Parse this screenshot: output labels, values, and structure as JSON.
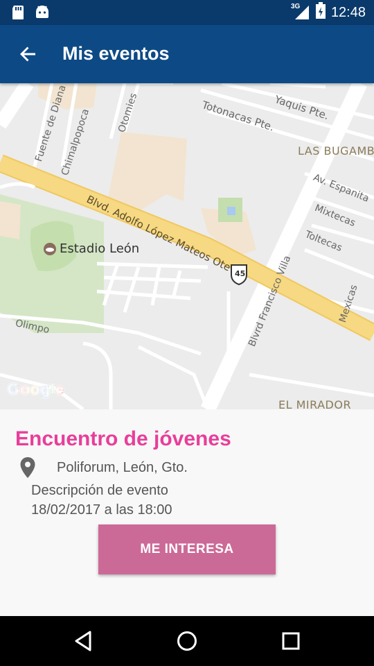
{
  "status_bar": {
    "network": "3G",
    "time": "12:48",
    "icons": [
      "sd-card-icon",
      "android-icon",
      "signal-icon",
      "battery-icon"
    ]
  },
  "app_bar": {
    "title": "Mis eventos",
    "back_icon": "arrow-back-icon"
  },
  "map": {
    "labels": {
      "totonacas": "Totonacas Pte.",
      "yaquis": "Yaquis Pte.",
      "fuente_diana": "Fuente de Diana",
      "chimalpopoca": "Chimalpopoca",
      "otomies": "Otomies",
      "las_bugamb": "LAS BUGAMB",
      "espanita": "Av. Espanita",
      "mixtecas": "Mixtecas",
      "toltecas": "Toltecas",
      "blvd_adolfo": "Blvd. Adolfo López Mateos Ote",
      "estadio": "Estadio León",
      "route_shield": "45",
      "blvrd_francisco": "Blvrd Francisco Villa",
      "mexicas": "Mexicas",
      "olimpo": "Olimpo",
      "el_mirador": "EL MIRADOR",
      "google": "Google"
    },
    "colors": {
      "land": "#ececec",
      "road": "#ffffff",
      "highway": "#f6d982",
      "park": "#d4e6c6",
      "building": "#f2e4d0",
      "poi": "#8a6b5d"
    }
  },
  "event": {
    "title": "Encuentro de jóvenes",
    "location": "Poliforum, León, Gto.",
    "description": "Descripción de evento",
    "date": "18/02/2017 a las 18:00",
    "button_label": "ME INTERESA",
    "title_color": "#e83e9a",
    "button_color": "#cc6a97"
  },
  "nav_bar": {
    "back_icon": "nav-back-icon",
    "home_icon": "nav-home-icon",
    "recents_icon": "nav-recents-icon"
  }
}
